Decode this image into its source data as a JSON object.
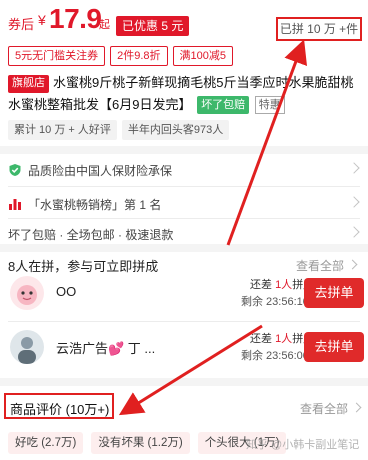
{
  "price": {
    "prefix": "券后",
    "symbol": "¥",
    "value": "17.9",
    "suffix": "起",
    "discount_tag": "已优惠 5 元",
    "sold_label": "已拼 10 万 +件"
  },
  "coupons": [
    "5元无门槛关注券",
    "2件9.8折",
    "满100减5"
  ],
  "title": {
    "store_badge": "旗舰店",
    "text": "水蜜桃9斤桃子新鲜现摘毛桃5斤当季应时水果脆甜桃水蜜桃整箱批发【6月9日发完】",
    "badge_green": "坏了包赔",
    "badge_gray": "特惠"
  },
  "stat_tags": [
    "累计 10 万 + 人好评",
    "半年内回头客973人"
  ],
  "info_rows": [
    {
      "icon": "shield-check-icon",
      "text": "品质险由中国人保财险承保"
    },
    {
      "icon": "ranking-icon",
      "text": "「水蜜桃畅销榜」第 1 名"
    },
    {
      "icon": "",
      "text": "坏了包赔 · 全场包邮 · 极速退款"
    }
  ],
  "group_buy": {
    "header": "8人在拼，参与可立即拼成",
    "see_all": "查看全部",
    "rows": [
      {
        "name": "OO",
        "need_prefix": "还差",
        "need_count": "1人",
        "need_suffix": "拼成",
        "timer": "剩余 23:56:10.5",
        "button": "去拼单"
      },
      {
        "name": "云浩广告💕 丁 ...",
        "need_prefix": "还差",
        "need_count": "1人",
        "need_suffix": "拼成",
        "timer": "剩余 23:56:00.5",
        "button": "去拼单"
      }
    ]
  },
  "reviews": {
    "title": "商品评价 (10万+)",
    "see_all": "查看全部",
    "tags": [
      "好吃 (2.7万)",
      "没有坏果 (1.2万)",
      "个头很大 (1万)"
    ]
  },
  "watermark": "知乎 @小韩卡副业笔记",
  "colors": {
    "accent": "#e0182a",
    "highlight_box": "#e02020",
    "green_badge": "#3db86b"
  }
}
